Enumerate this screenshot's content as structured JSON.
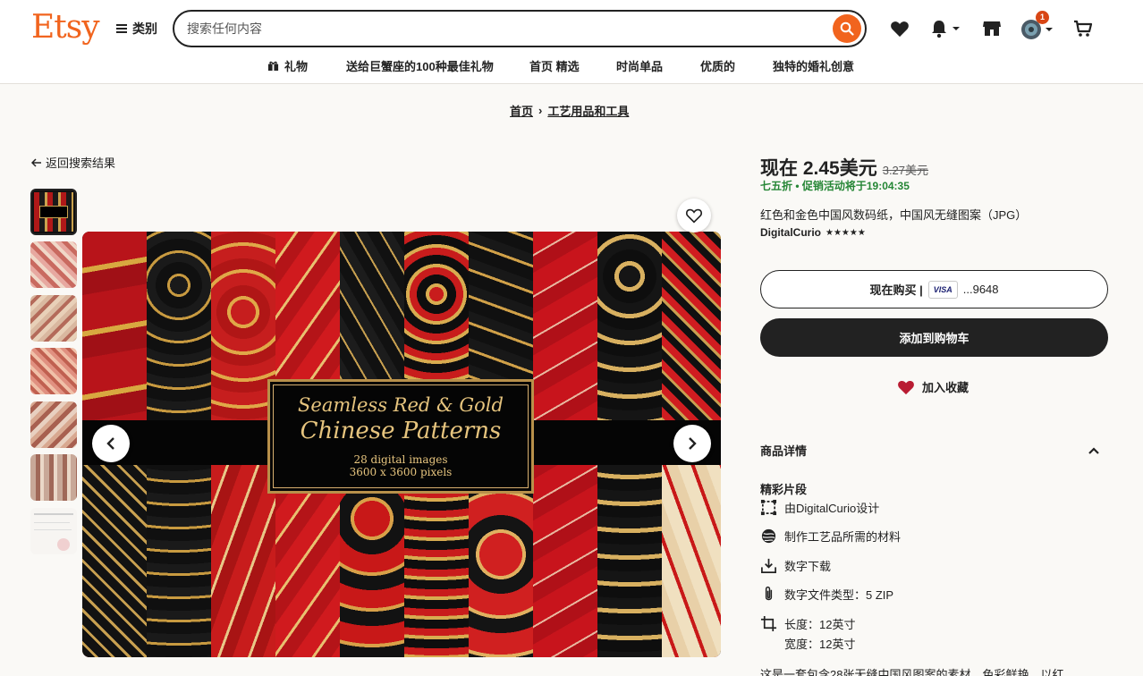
{
  "header": {
    "logo": "Etsy",
    "categories_label": "类别",
    "search_placeholder": "搜索任何内容",
    "cart_badge": "1"
  },
  "nav": [
    {
      "label": "礼物"
    },
    {
      "label": "送给巨蟹座的100种最佳礼物"
    },
    {
      "label": "首页 精选"
    },
    {
      "label": "时尚单品"
    },
    {
      "label": "优质的"
    },
    {
      "label": "独特的婚礼创意"
    }
  ],
  "breadcrumb": {
    "home": "首页",
    "sep": "›",
    "category": "工艺用品和工具"
  },
  "back_link": "返回搜索结果",
  "image": {
    "title_line1": "Seamless Red & Gold",
    "title_line2": "Chinese Patterns",
    "subtitle1": "28 digital images",
    "subtitle2": "3600 x 3600 pixels"
  },
  "product": {
    "price_now": "现在 2.45美元",
    "price_old": "3.27美元",
    "sale_text": "七五折 • 促销活动将于19:04:35",
    "title": "红色和金色中国风数码纸，中国风无缝图案（JPG）",
    "shop_name": "DigitalCurio",
    "stars": "★★★★★",
    "buy_now": "现在购买 |",
    "card_label": "VISA",
    "card_digits": "...9648",
    "add_to_cart": "添加到购物车",
    "add_fav": "加入收藏"
  },
  "details": {
    "heading": "商品详情",
    "highlights": "精彩片段",
    "designer": "由DigitalCurio设计",
    "materials": "制作工艺品所需的材料",
    "download": "数字下载",
    "filetype": "数字文件类型：5 ZIP",
    "length": "长度：12英寸",
    "width": "宽度：12英寸",
    "description": "这是一套包含28张无缝中国风图案的素材，色彩鲜艳，以红"
  },
  "colors": {
    "accent": "#f1641e",
    "sale_green": "#258635",
    "fav_red": "#b91c32",
    "dark": "#222222"
  }
}
